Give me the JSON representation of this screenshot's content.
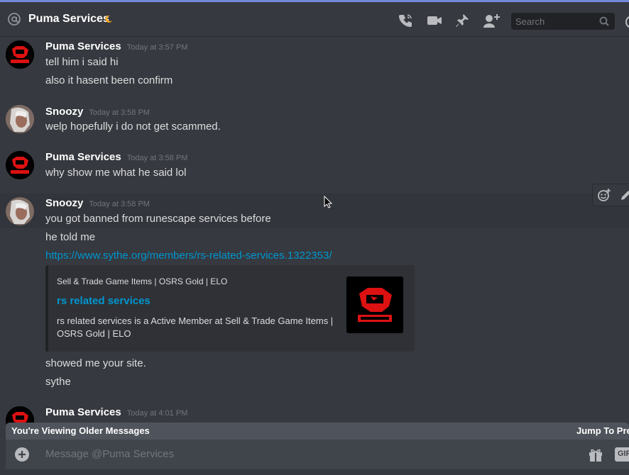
{
  "header": {
    "title": "Puma Services",
    "search_placeholder": "Search"
  },
  "messages": [
    {
      "author": "Puma Services",
      "time": "Today at 3:57 PM",
      "lines": [
        "tell him i said hi",
        "also it hasent been confirm"
      ]
    },
    {
      "author": "Snoozy",
      "time": "Today at 3:58 PM",
      "lines": [
        "welp hopefully i do not get scammed."
      ]
    },
    {
      "author": "Puma Services",
      "time": "Today at 3:58 PM",
      "lines": [
        "why show me what he said lol"
      ]
    },
    {
      "author": "Snoozy",
      "time": "Today at 3:58 PM",
      "lines": [
        "you got banned from runescape services before",
        "he told me",
        "https://www.sythe.org/members/rs-related-services.1322353/",
        "showed me your site.",
        "sythe"
      ]
    },
    {
      "author": "Puma Services",
      "time": "Today at 4:01 PM",
      "lines": []
    }
  ],
  "embed": {
    "provider": "Sell & Trade Game Items | OSRS Gold | ELO",
    "title": "rs related services",
    "description": "rs related services is a Active Member at Sell & Trade Game Items | OSRS Gold | ELO"
  },
  "older_bar": {
    "text": "You're Viewing Older Messages",
    "jump": "Jump To Present"
  },
  "composer": {
    "placeholder": "Message @Puma Services",
    "gif_label": "GIF"
  },
  "icons": [
    "at-icon",
    "moon-icon",
    "call-icon",
    "video-icon",
    "pin-icon",
    "add-user-icon",
    "search-icon",
    "help-icon",
    "add-reaction-icon",
    "edit-icon",
    "plus-icon",
    "gift-icon",
    "cursor-icon"
  ],
  "colors": {
    "background": "#36393f",
    "link": "#0096cf",
    "accent": "#7289da",
    "status": "#faa61a"
  }
}
